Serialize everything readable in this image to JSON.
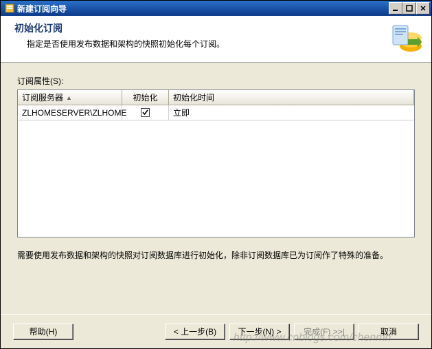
{
  "window": {
    "title": "新建订阅向导"
  },
  "header": {
    "title": "初始化订阅",
    "subtitle": "指定是否使用发布数据和架构的快照初始化每个订阅。"
  },
  "content": {
    "label": "订阅属性(S):",
    "columns": {
      "server": "订阅服务器",
      "init": "初始化",
      "when": "初始化时间"
    },
    "rows": [
      {
        "server": "ZLHOMESERVER\\ZLHOME",
        "init": true,
        "when": "立即"
      }
    ],
    "note": "需要使用发布数据和架构的快照对订阅数据库进行初始化，除非订阅数据库已为订阅作了特殊的准备。"
  },
  "footer": {
    "help": "帮助(H)",
    "back": "< 上一步(B)",
    "next": "下一步(N) >",
    "finish": "完成(F) >>|",
    "cancel": "取消"
  },
  "watermark": "http://www.cnblogs.com/chenmh"
}
